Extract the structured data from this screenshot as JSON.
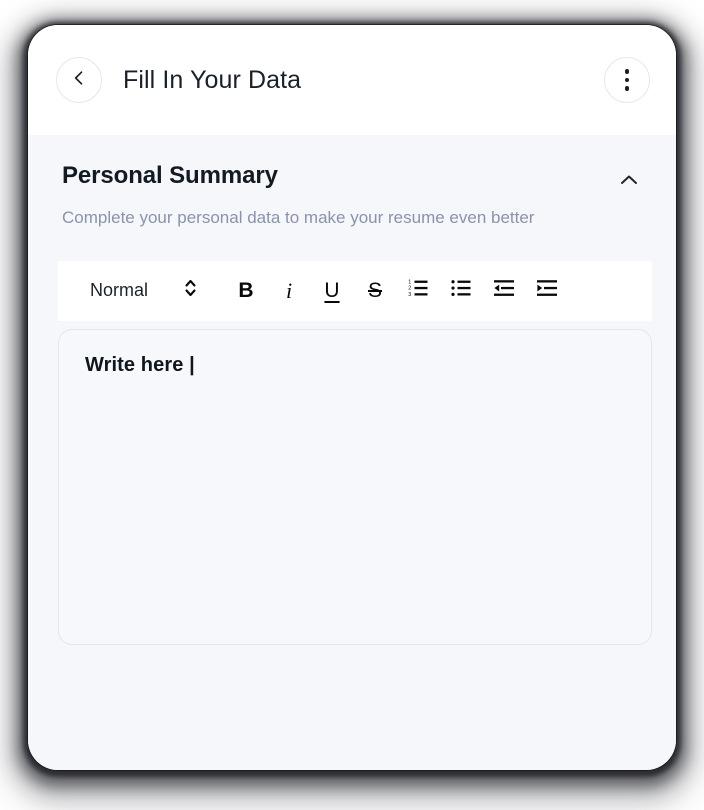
{
  "appbar": {
    "back_icon": "chevron-left-icon",
    "title": "Fill In Your Data",
    "overflow_icon": "more-vertical-icon"
  },
  "section": {
    "title": "Personal Summary",
    "subtitle": "Complete your personal data to make your resume even better",
    "collapse_icon": "chevron-up-icon"
  },
  "toolbar": {
    "style_value": "Normal",
    "style_caret_icon": "chevron-up-down-icon",
    "buttons": [
      {
        "name": "bold-button",
        "label": "B",
        "icon": "bold-icon"
      },
      {
        "name": "italic-button",
        "label": "i",
        "icon": "italic-icon"
      },
      {
        "name": "underline-button",
        "label": "U",
        "icon": "underline-icon"
      },
      {
        "name": "strikethrough-button",
        "label": "S",
        "icon": "strikethrough-icon"
      },
      {
        "name": "numbered-list-button",
        "label": "",
        "icon": "numbered-list-icon"
      },
      {
        "name": "bulleted-list-button",
        "label": "",
        "icon": "bulleted-list-icon"
      },
      {
        "name": "outdent-button",
        "label": "",
        "icon": "outdent-icon"
      },
      {
        "name": "indent-button",
        "label": "",
        "icon": "indent-icon"
      }
    ]
  },
  "editor": {
    "value": "Write here |",
    "placeholder": "Write here"
  },
  "colors": {
    "page_background": "#f6f7fb",
    "appbar_background": "#ffffff",
    "title_text": "#1a2029",
    "subtitle_text": "#8b93ab",
    "toolbar_background": "#ffffff",
    "editor_background": "#f7f8fc",
    "editor_border": "#e4e6ef"
  }
}
